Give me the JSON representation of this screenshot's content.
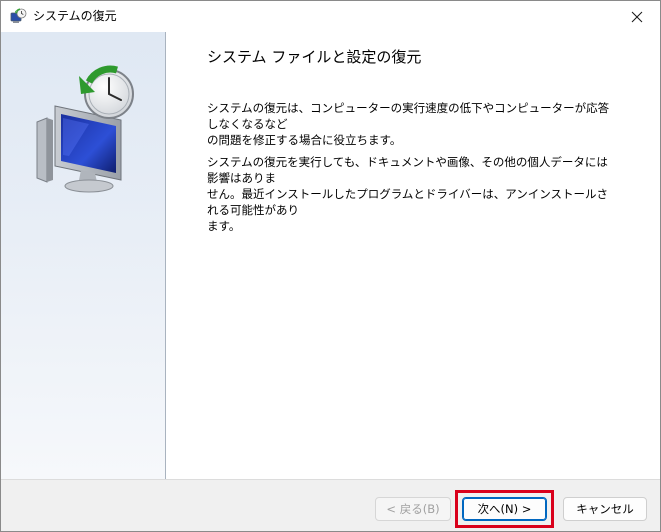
{
  "window": {
    "title": "システムの復元",
    "title_icon": "system-restore-icon",
    "close_icon": "close-icon"
  },
  "side_panel": {
    "graphic_icon": "system-restore-computer-clock-icon"
  },
  "content": {
    "heading": "システム ファイルと設定の復元",
    "paragraph1": "システムの復元は、コンピューターの実行速度の低下やコンピューターが応答しなくなるなど\nの問題を修正する場合に役立ちます。",
    "paragraph2": "システムの復元を実行しても、ドキュメントや画像、その他の個人データには影響はありま\nせん。最近インストールしたプログラムとドライバーは、アンインストールされる可能性があり\nます。"
  },
  "footer": {
    "back_label": "< 戻る(B)",
    "back_enabled": false,
    "next_label": "次へ(N) >",
    "cancel_label": "キャンセル",
    "highlight_color": "#d9001b",
    "accent_color": "#0067c0"
  }
}
